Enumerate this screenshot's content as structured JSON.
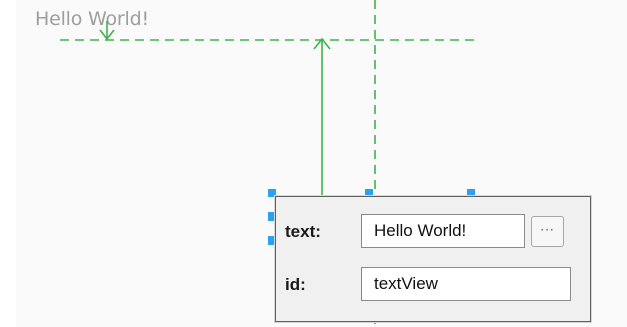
{
  "canvas": {
    "preview_text": "Hello World!"
  },
  "properties_popup": {
    "rows": [
      {
        "label": "text:",
        "value": "Hello World!",
        "has_more_button": true,
        "more_label": "···"
      },
      {
        "label": "id:",
        "value": "textView",
        "has_more_button": false
      }
    ]
  },
  "colors": {
    "guide_green": "#3cb54a",
    "handle_blue": "#29a3ef",
    "preview_text_gray": "#9e9e9e"
  },
  "icons": [
    "up-arrow-icon",
    "down-arrow-icon",
    "more-dots-icon"
  ]
}
